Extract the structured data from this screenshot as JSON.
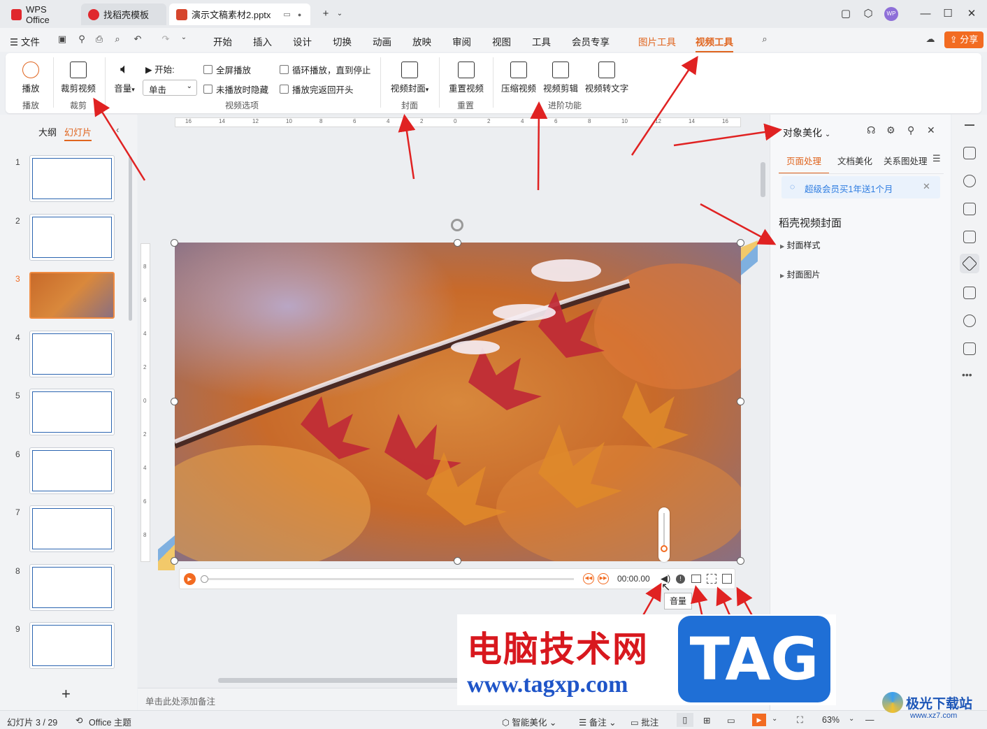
{
  "tabs": [
    {
      "label": "WPS Office",
      "icon": "wps-logo-icon",
      "color": "#e0282d"
    },
    {
      "label": "找稻壳模板",
      "icon": "docer-logo-icon",
      "color": "#e0282d"
    },
    {
      "label": "演示文稿素材2.pptx",
      "icon": "ppt-file-icon",
      "color": "#d6462d"
    }
  ],
  "menu": {
    "file": "文件",
    "items": [
      "开始",
      "插入",
      "设计",
      "切换",
      "动画",
      "放映",
      "审阅",
      "视图",
      "工具",
      "会员专享"
    ],
    "context": [
      "图片工具",
      "视频工具"
    ],
    "share": "分享",
    "accent": "#f26b21"
  },
  "ribbon": {
    "play": "播放",
    "play_group": "播放",
    "trim": "裁剪视频",
    "trim_group": "裁剪",
    "volume": "音量",
    "start_label": "开始:",
    "start_value": "单击",
    "fullscreen": "全屏播放",
    "hide": "未播放时隐藏",
    "loop": "循环播放，直到停止",
    "rewind": "播放完返回开头",
    "options_group": "视频选项",
    "cover": "视频封面",
    "cover_group": "封面",
    "reset": "重置视频",
    "reset_group": "重置",
    "compress": "压缩视频",
    "edit": "视频剪辑",
    "totext": "视频转文字",
    "advanced_group": "进阶功能"
  },
  "left": {
    "outline": "大纲",
    "slides": "幻灯片",
    "add": "+"
  },
  "ruler": [
    "16",
    "14",
    "12",
    "10",
    "8",
    "6",
    "4",
    "2",
    "0",
    "2",
    "4",
    "6",
    "8",
    "10",
    "12",
    "14",
    "16"
  ],
  "vruler": [
    "8",
    "6",
    "4",
    "2",
    "0",
    "2",
    "4",
    "6",
    "8"
  ],
  "player": {
    "time": "00:00.00",
    "tooltip": "音量"
  },
  "notes": "单击此处添加备注",
  "right": {
    "title": "对象美化",
    "tabs": [
      "页面处理",
      "文档美化",
      "关系图处理"
    ],
    "promo": "超级会员买1年送1个月",
    "section": "稻壳视频封面",
    "items": [
      "封面样式",
      "封面图片"
    ]
  },
  "status": {
    "slide": "幻灯片 3 / 29",
    "theme": "Office 主题",
    "beautify": "智能美化",
    "notes": "备注",
    "comment": "批注",
    "zoom": "63%"
  },
  "watermark": {
    "cn": "电脑技术网",
    "url": "www.tagxp.com",
    "tag": "TAG",
    "logo": "极光下载站",
    "logo_url": "www.xz7.com"
  }
}
